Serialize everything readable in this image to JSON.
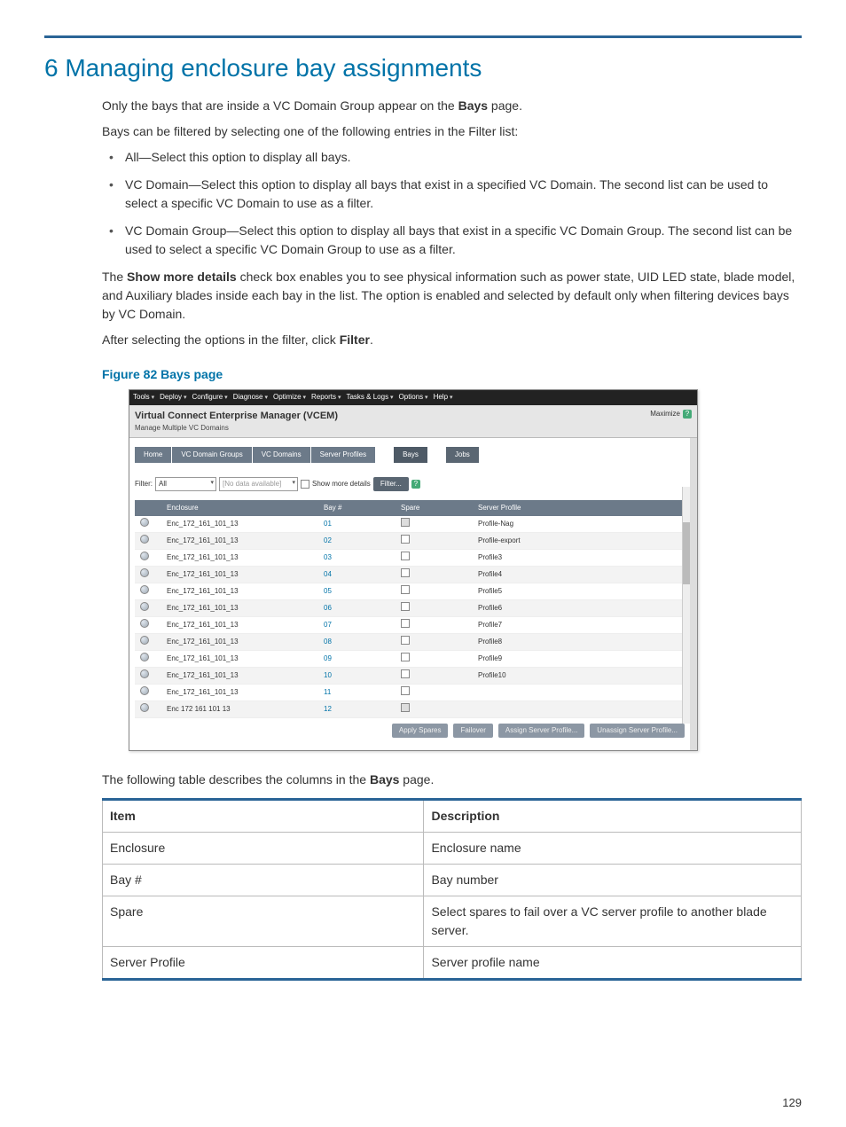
{
  "heading": "6 Managing enclosure bay assignments",
  "intro": {
    "p1_a": "Only the bays that are inside a VC Domain Group appear on the ",
    "p1_bold": "Bays",
    "p1_b": " page.",
    "p2": "Bays can be filtered by selecting one of the following entries in the Filter list:"
  },
  "bullets": {
    "b1": "All—Select this option to display all bays.",
    "b2": "VC Domain—Select this option to display all bays that exist in a specified VC Domain. The second list can be used to select a specific VC Domain to use as a filter.",
    "b3": "VC Domain Group—Select this option to display all bays that exist in a specific VC Domain Group. The second list can be used to select a specific VC Domain Group to use as a filter."
  },
  "after_bullets": {
    "p1_a": "The ",
    "p1_bold": "Show more details",
    "p1_b": " check box enables you to see physical information such as power state, UID LED state, blade model, and Auxiliary blades inside each bay in the list. The option is enabled and selected by default only when filtering devices bays by VC Domain.",
    "p2_a": "After selecting the options in the filter, click ",
    "p2_bold": "Filter",
    "p2_b": "."
  },
  "figure_caption": "Figure 82 Bays page",
  "screenshot": {
    "menus": [
      "Tools",
      "Deploy",
      "Configure",
      "Diagnose",
      "Optimize",
      "Reports",
      "Tasks & Logs",
      "Options",
      "Help"
    ],
    "title": "Virtual Connect Enterprise Manager (VCEM)",
    "subtitle": "Manage Multiple VC Domains",
    "maximize": "Maximize",
    "help_icon": "?",
    "tabs": [
      "Home",
      "VC Domain Groups",
      "VC Domains",
      "Server Profiles",
      "Bays",
      "Jobs"
    ],
    "active_tab": "Bays",
    "filter_label": "Filter:",
    "filter_value": "All",
    "filter_secondary": "[No data available]",
    "show_more_label": "Show more details",
    "filter_button": "Filter...",
    "columns": [
      "",
      "Enclosure",
      "Bay #",
      "Spare",
      "Server Profile"
    ],
    "rows": [
      {
        "enc": "Enc_172_161_101_13",
        "bay": "01",
        "spare": "dis",
        "profile": "Profile-Nag"
      },
      {
        "enc": "Enc_172_161_101_13",
        "bay": "02",
        "spare": "",
        "profile": "Profile-export"
      },
      {
        "enc": "Enc_172_161_101_13",
        "bay": "03",
        "spare": "",
        "profile": "Profile3"
      },
      {
        "enc": "Enc_172_161_101_13",
        "bay": "04",
        "spare": "",
        "profile": "Profile4"
      },
      {
        "enc": "Enc_172_161_101_13",
        "bay": "05",
        "spare": "",
        "profile": "Profile5"
      },
      {
        "enc": "Enc_172_161_101_13",
        "bay": "06",
        "spare": "",
        "profile": "Profile6"
      },
      {
        "enc": "Enc_172_161_101_13",
        "bay": "07",
        "spare": "",
        "profile": "Profile7"
      },
      {
        "enc": "Enc_172_161_101_13",
        "bay": "08",
        "spare": "",
        "profile": "Profile8"
      },
      {
        "enc": "Enc_172_161_101_13",
        "bay": "09",
        "spare": "",
        "profile": "Profile9"
      },
      {
        "enc": "Enc_172_161_101_13",
        "bay": "10",
        "spare": "",
        "profile": "Profile10"
      },
      {
        "enc": "Enc_172_161_101_13",
        "bay": "11",
        "spare": "",
        "profile": ""
      },
      {
        "enc": "Enc 172 161 101 13",
        "bay": "12",
        "spare": "dis",
        "profile": ""
      }
    ],
    "actions": [
      "Apply Spares",
      "Failover",
      "Assign Server Profile...",
      "Unassign Server Profile..."
    ]
  },
  "after_figure": {
    "p1_a": "The following table describes the columns in the ",
    "p1_bold": "Bays",
    "p1_b": " page."
  },
  "desc_table": {
    "headers": [
      "Item",
      "Description"
    ],
    "rows": [
      [
        "Enclosure",
        "Enclosure name"
      ],
      [
        "Bay #",
        "Bay number"
      ],
      [
        "Spare",
        "Select spares to fail over a VC server profile to another blade server."
      ],
      [
        "Server Profile",
        "Server profile name"
      ]
    ]
  },
  "page_number": "129"
}
